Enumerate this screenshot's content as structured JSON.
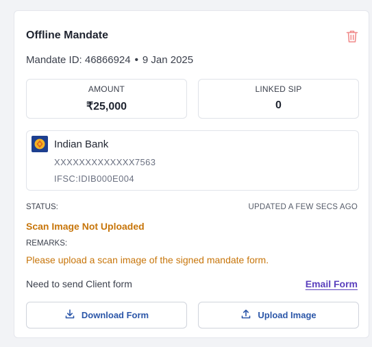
{
  "card": {
    "title": "Offline Mandate",
    "mandate_id": "Mandate ID: 46866924",
    "separator": "•",
    "date": "9 Jan 2025"
  },
  "stats": {
    "amount_label": "AMOUNT",
    "amount_value": "₹25,000",
    "linked_sip_label": "LINKED SIP",
    "linked_sip_value": "0"
  },
  "bank": {
    "name": "Indian Bank",
    "account": "XXXXXXXXXXXXX7563",
    "ifsc": "IFSC:IDIB000E004"
  },
  "status": {
    "label": "STATUS:",
    "updated": "UPDATED A FEW SECS AGO",
    "value": "Scan Image Not Uploaded",
    "remarks_label": "REMARKS:",
    "remarks_value": "Please upload a scan image of the signed mandate form."
  },
  "client_form": {
    "text": "Need to send Client form",
    "email_link": "Email Form"
  },
  "buttons": {
    "download": "Download Form",
    "upload": "Upload Image"
  },
  "icons": {
    "delete": "trash-icon",
    "bank_logo": "indian-bank-logo",
    "download": "download-icon",
    "upload": "upload-icon"
  },
  "colors": {
    "warning": "#c7750a",
    "link": "#5a3fbd",
    "button_text": "#2b56a8",
    "delete_icon": "#f08a8a"
  }
}
